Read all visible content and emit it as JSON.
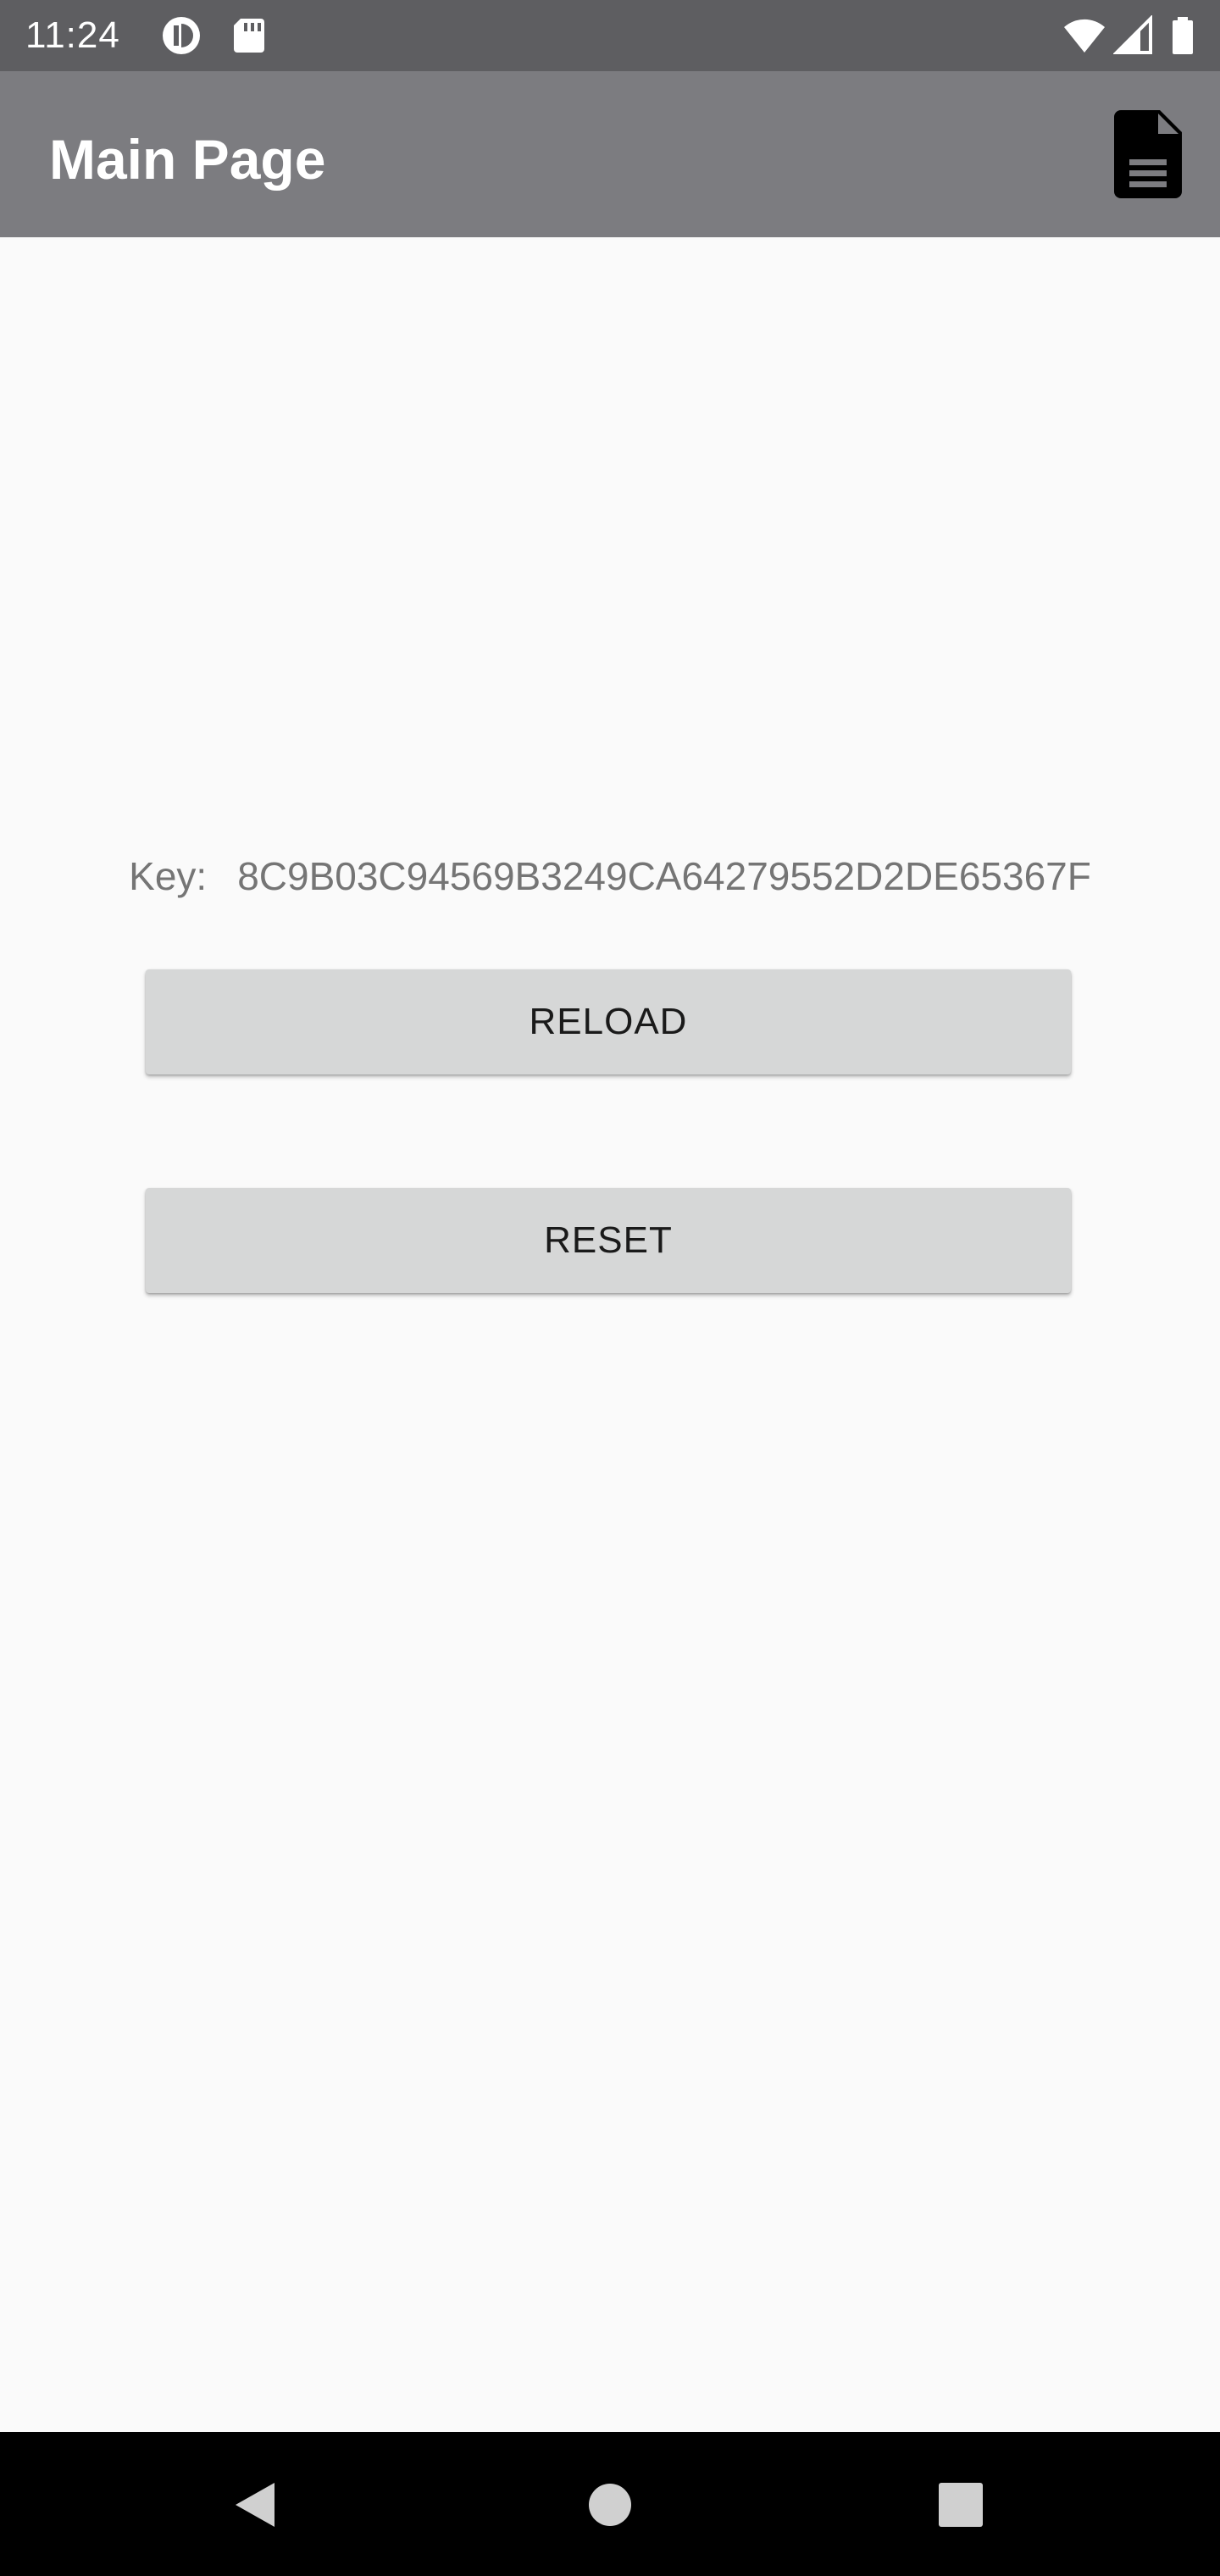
{
  "status_bar": {
    "time": "11:24",
    "left_icons": [
      "app-notification-icon",
      "sd-card-icon"
    ],
    "right_icons": [
      "wifi-icon",
      "cell-signal-icon",
      "battery-icon"
    ]
  },
  "app_bar": {
    "title": "Main Page",
    "action_icon": "document-icon"
  },
  "content": {
    "key_label": "Key:",
    "key_value": "8C9B03C94569B3249CA64279552D2DE65367F",
    "reload_label": "RELOAD",
    "reset_label": "RESET"
  },
  "nav_bar": {
    "icons": [
      "back-icon",
      "home-icon",
      "recents-icon"
    ]
  },
  "colors": {
    "status_bar": "#5e5e61",
    "app_bar": "#7c7c80",
    "background": "#fafafa",
    "button": "#d6d7d7",
    "key_text": "#757575",
    "nav_bar": "#000000"
  }
}
